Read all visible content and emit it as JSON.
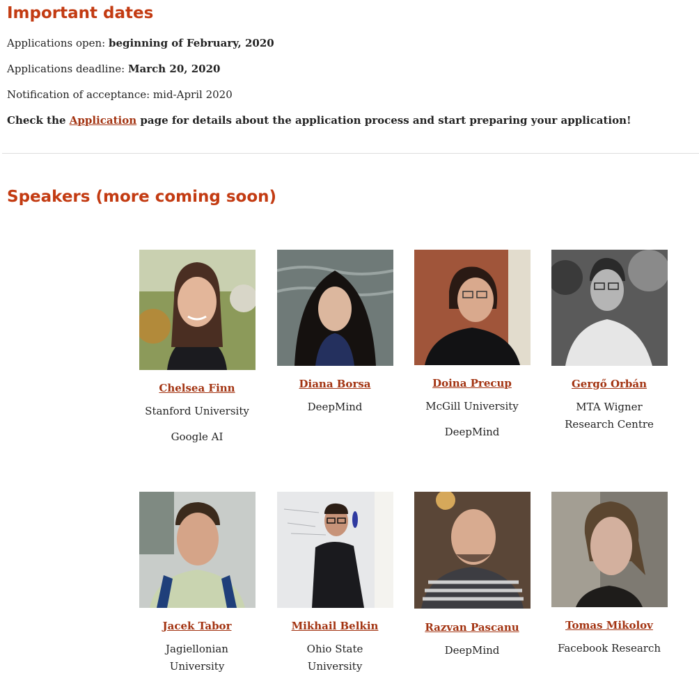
{
  "dates": {
    "title": "Important dates",
    "open_label": "Applications open: ",
    "open_value": "beginning of February, 2020",
    "deadline_label": "Applications deadline: ",
    "deadline_value": "March 20, 2020",
    "notification": "Notification of acceptance: mid-April 2020",
    "check_prefix": "Check the ",
    "check_link": "Application",
    "check_suffix": " page for details about the application process and start preparing your application!"
  },
  "speakers": {
    "title": "Speakers (more coming soon)",
    "items": [
      {
        "name": "Chelsea Finn",
        "aff": [
          "Stanford University",
          "Google AI"
        ]
      },
      {
        "name": "Diana Borsa",
        "aff": [
          "DeepMind"
        ]
      },
      {
        "name": "Doina Precup",
        "aff": [
          "McGill University",
          "DeepMind"
        ]
      },
      {
        "name": "Gergő Orbán",
        "aff": [
          "MTA Wigner Research Centre"
        ]
      },
      {
        "name": "Jacek Tabor",
        "aff": [
          "Jagiellonian University"
        ]
      },
      {
        "name": "Mikhail Belkin",
        "aff": [
          "Ohio State University"
        ]
      },
      {
        "name": "Razvan Pascanu",
        "aff": [
          "DeepMind"
        ]
      },
      {
        "name": "Tomas Mikolov",
        "aff": [
          "Facebook Research"
        ]
      }
    ]
  },
  "colors": {
    "heading": "#c33b12",
    "link": "#a33412"
  }
}
